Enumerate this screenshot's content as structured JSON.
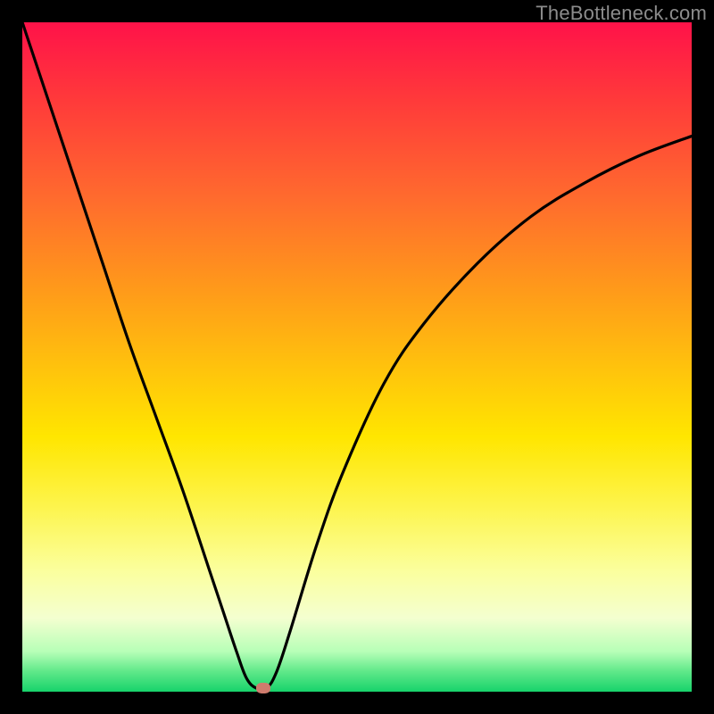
{
  "watermark": "TheBottleneck.com",
  "colors": {
    "frame": "#000000",
    "curve": "#000000",
    "marker": "#cf7b6d",
    "gradient_top": "#ff1249",
    "gradient_bottom": "#17d36b"
  },
  "chart_data": {
    "type": "line",
    "title": "",
    "xlabel": "",
    "ylabel": "",
    "xlim": [
      0,
      100
    ],
    "ylim": [
      0,
      100
    ],
    "grid": false,
    "note": "Axes unlabeled; y interpreted as bottleneck % (0 at bottom, 100 at top). Minimum near x≈35.",
    "series": [
      {
        "name": "bottleneck-curve",
        "x": [
          0,
          4,
          8,
          12,
          16,
          20,
          24,
          28,
          30,
          32,
          33.5,
          35,
          36.5,
          38,
          40,
          44,
          48,
          54,
          60,
          68,
          76,
          84,
          92,
          100
        ],
        "y": [
          100,
          88,
          76,
          64,
          52,
          41,
          30,
          18,
          12,
          6,
          2,
          0.5,
          0.5,
          3,
          9,
          22,
          33,
          46,
          55,
          64,
          71,
          76,
          80,
          83
        ]
      }
    ],
    "marker": {
      "x": 36,
      "y": 0.5
    }
  }
}
